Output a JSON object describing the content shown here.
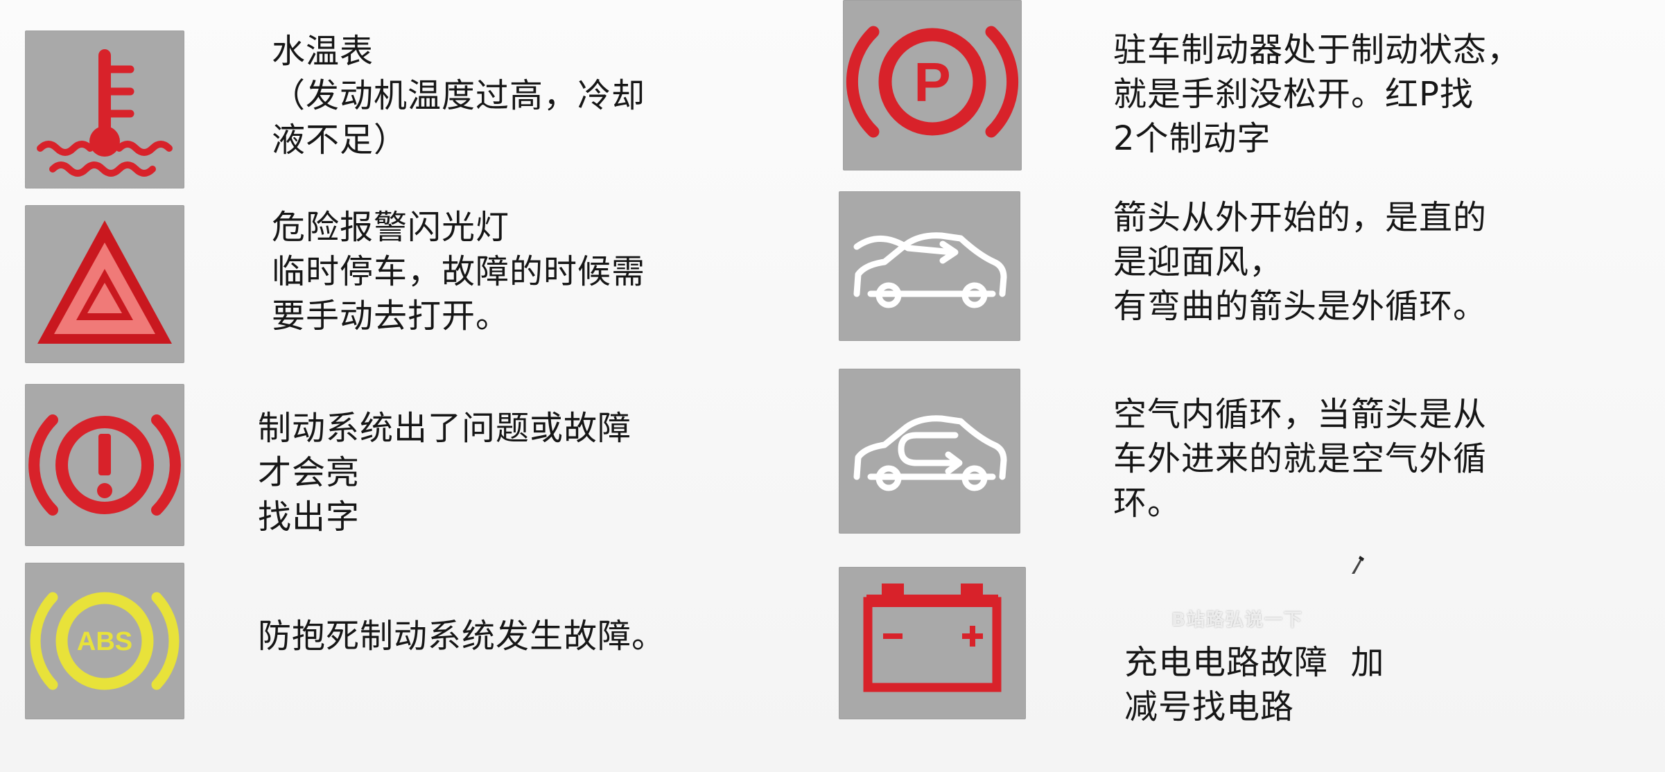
{
  "indicators": [
    {
      "id": "coolant",
      "icon": "coolant-temperature-icon",
      "color": "#d8222a",
      "lines": [
        "水温表",
        "（发动机温度过高，冷却",
        "液不足）"
      ]
    },
    {
      "id": "hazard",
      "icon": "hazard-warning-icon",
      "color": "#d8222a",
      "lines": [
        "危险报警闪光灯",
        "临时停车，故障的时候需",
        "要手动去打开。"
      ]
    },
    {
      "id": "brake-system",
      "icon": "brake-warning-icon",
      "color": "#d8222a",
      "lines": [
        "制动系统出了问题或故障",
        "才会亮",
        "找出字"
      ]
    },
    {
      "id": "abs",
      "icon": "abs-icon",
      "icon_text": "ABS",
      "color": "#e8e23a",
      "lines": [
        "防抱死制动系统发生故障。"
      ]
    },
    {
      "id": "parking-brake",
      "icon": "parking-brake-icon",
      "icon_text": "P",
      "color": "#d8222a",
      "lines": [
        "驻车制动器处于制动状态，",
        "就是手刹没松开。红P找",
        "2个制动字"
      ]
    },
    {
      "id": "outside-air",
      "icon": "outside-air-circulation-icon",
      "color": "#ffffff",
      "lines": [
        "箭头从外开始的，是直的",
        "是迎面风，",
        "有弯曲的箭头是外循环。"
      ]
    },
    {
      "id": "inside-air",
      "icon": "recirculation-icon",
      "color": "#ffffff",
      "lines": [
        "空气内循环，当箭头是从",
        "车外进来的就是空气外循",
        "环。"
      ]
    },
    {
      "id": "battery",
      "icon": "battery-icon",
      "color": "#d8222a",
      "lines": [
        "充电电路故障  加",
        "减号找电路"
      ]
    }
  ],
  "watermark": "B站路弘说一下"
}
